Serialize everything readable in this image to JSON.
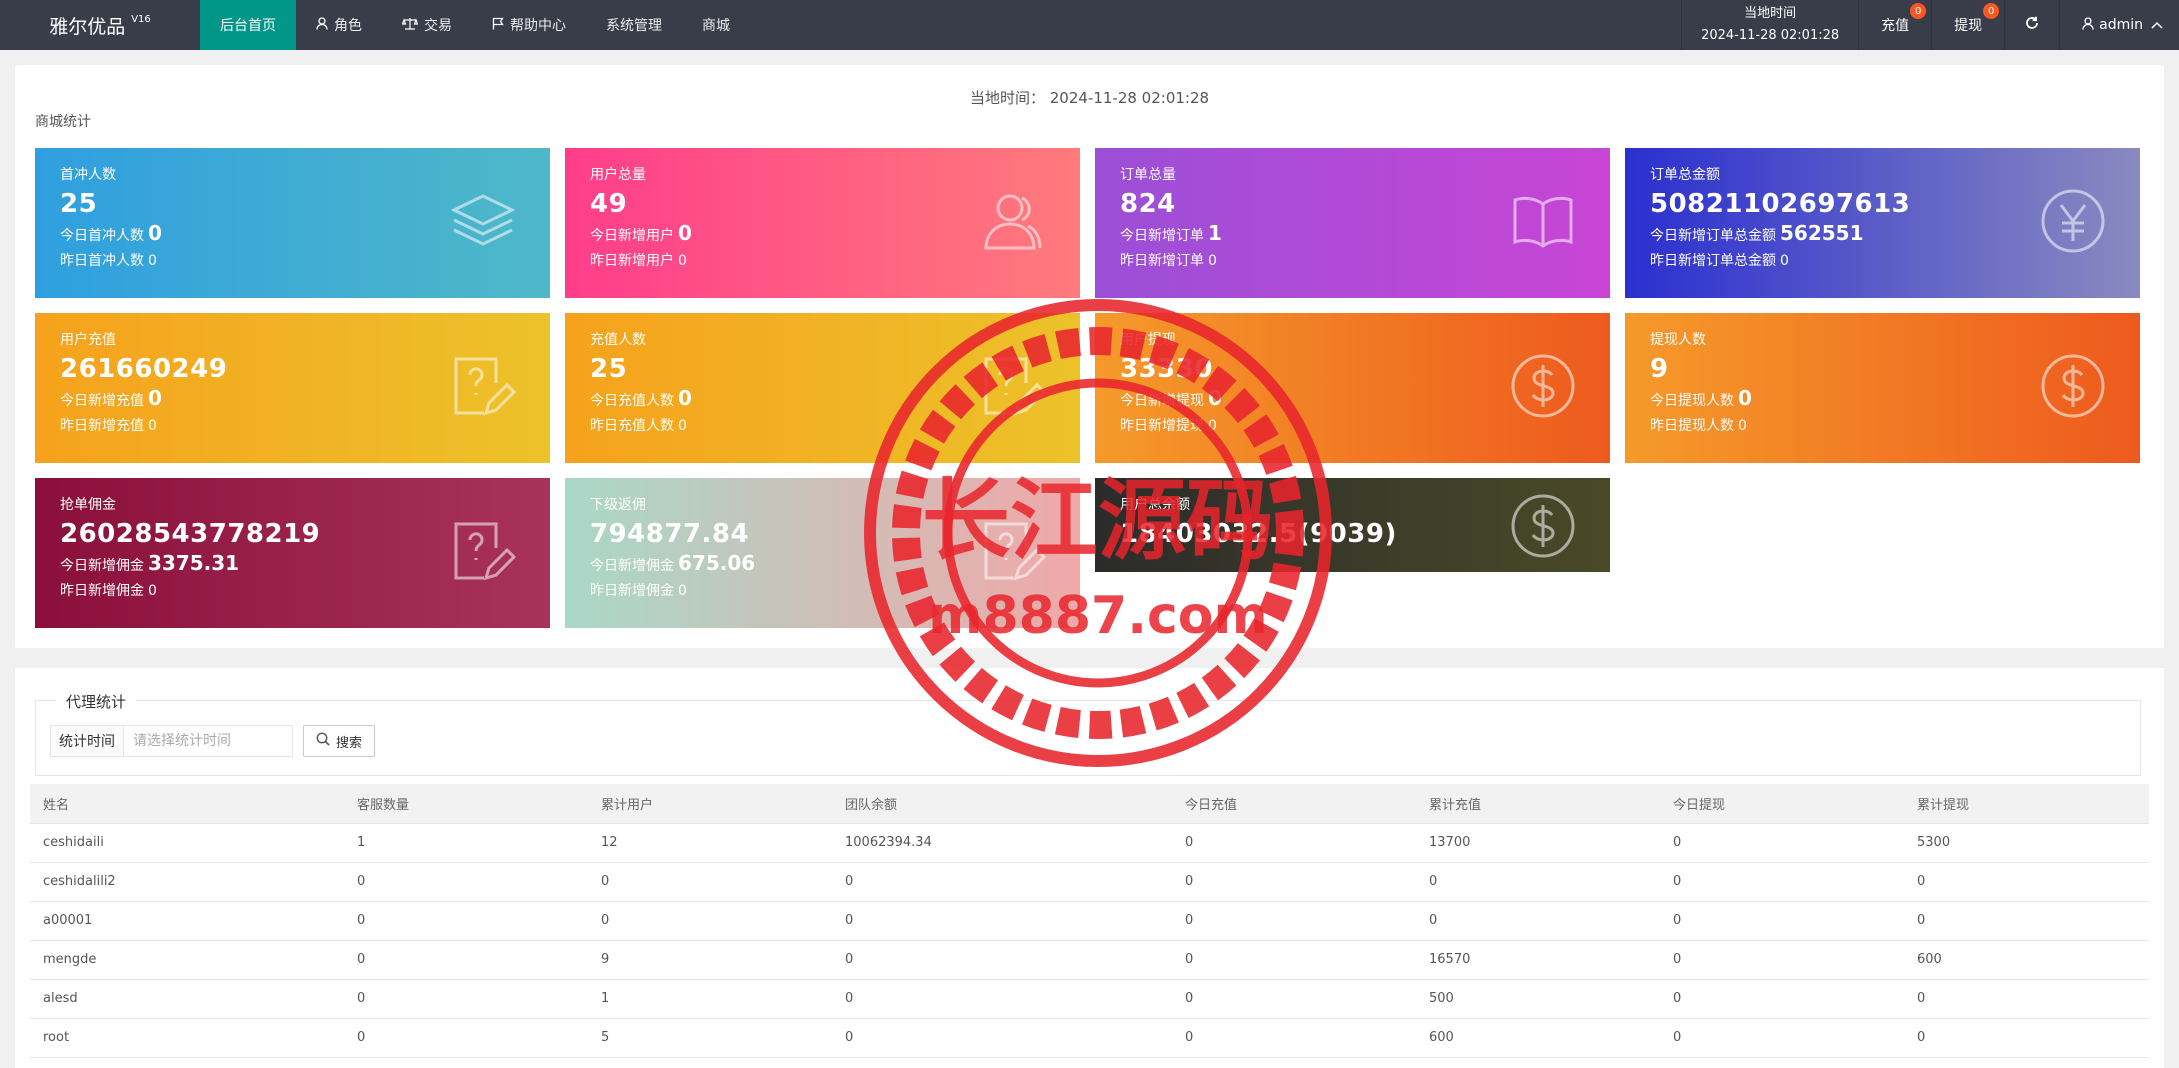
{
  "app": {
    "name": "雅尔优品",
    "version": "V16"
  },
  "nav": [
    {
      "label": "后台首页",
      "icon": ""
    },
    {
      "label": "角色",
      "icon": "user-icon"
    },
    {
      "label": "交易",
      "icon": "scale-icon"
    },
    {
      "label": "帮助中心",
      "icon": "flag-icon"
    },
    {
      "label": "系统管理",
      "icon": ""
    },
    {
      "label": "商城",
      "icon": ""
    }
  ],
  "header": {
    "time_label": "当地时间",
    "time_value": "2024-11-28 02:01:28",
    "recharge_label": "充值",
    "recharge_badge": "0",
    "withdraw_label": "提现",
    "withdraw_badge": "0",
    "user": "admin"
  },
  "dashboard": {
    "local_time_prefix": "当地时间：",
    "local_time": "2024-11-28 02:01:28",
    "section_title": "商城统计",
    "cards": [
      {
        "label": "首冲人数",
        "value": "25",
        "today_label": "今日首冲人数",
        "today": "0",
        "yest_label": "昨日首冲人数",
        "yest": "0",
        "icon": "layers-icon",
        "bg": [
          "#2f9fe0",
          "#4fb8c8"
        ]
      },
      {
        "label": "用户总量",
        "value": "49",
        "today_label": "今日新增用户",
        "today": "0",
        "yest_label": "昨日新增用户",
        "yest": "0",
        "icon": "users-icon",
        "bg": [
          "#ff3d8b",
          "#ff7b7b"
        ]
      },
      {
        "label": "订单总量",
        "value": "824",
        "today_label": "今日新增订单",
        "today": "1",
        "yest_label": "昨日新增订单",
        "yest": "0",
        "icon": "book-icon",
        "bg": [
          "#9b4fd6",
          "#c845d6"
        ]
      },
      {
        "label": "订单总金额",
        "value": "50821102697613",
        "today_label": "今日新增订单总金额",
        "today": "562551",
        "yest_label": "昨日新增订单总金额",
        "yest": "0",
        "icon": "yen-icon",
        "bg": [
          "#2b2fcf",
          "#8a8ac0"
        ]
      },
      {
        "label": "用户充值",
        "value": "261660249",
        "today_label": "今日新增充值",
        "today": "0",
        "yest_label": "昨日新增充值",
        "yest": "0",
        "icon": "edit-doc-icon",
        "bg": [
          "#f6a21c",
          "#ecc22a"
        ]
      },
      {
        "label": "充值人数",
        "value": "25",
        "today_label": "今日充值人数",
        "today": "0",
        "yest_label": "昨日充值人数",
        "yest": "0",
        "icon": "edit-doc-icon",
        "bg": [
          "#f6a21c",
          "#ecc22a"
        ]
      },
      {
        "label": "用户提现",
        "value": "33330",
        "today_label": "今日新增提现",
        "today": "0",
        "yest_label": "昨日新增提现",
        "yest": "0",
        "icon": "dollar-icon",
        "bg": [
          "#f59a2a",
          "#ee5a1e"
        ]
      },
      {
        "label": "提现人数",
        "value": "9",
        "today_label": "今日提现人数",
        "today": "0",
        "yest_label": "昨日提现人数",
        "yest": "0",
        "icon": "dollar-icon",
        "bg": [
          "#f59a2a",
          "#ee5a1e"
        ]
      },
      {
        "label": "抢单佣金",
        "value": "26028543778219",
        "today_label": "今日新增佣金",
        "today": "3375.31",
        "yest_label": "昨日新增佣金",
        "yest": "0",
        "icon": "edit-doc-icon",
        "bg": [
          "#8a0f3a",
          "#a8335a"
        ]
      },
      {
        "label": "下级返佣",
        "value": "794877.84",
        "today_label": "今日新增佣金",
        "today": "675.06",
        "yest_label": "昨日新增佣金",
        "yest": "0",
        "icon": "edit-doc-icon",
        "bg": [
          "#a9d8c8",
          "#f0a8a8"
        ]
      },
      {
        "label": "用户总余额",
        "value": "18403032.5(9039)",
        "icon": "dollar-icon",
        "bg": [
          "#2b2b2b",
          "#4a4a28"
        ]
      }
    ]
  },
  "agents": {
    "legend": "代理统计",
    "search_label": "统计时间",
    "search_placeholder": "请选择统计时间",
    "search_button": "搜索",
    "columns": [
      "姓名",
      "客服数量",
      "累计用户",
      "团队余额",
      "今日充值",
      "累计充值",
      "今日提现",
      "累计提现"
    ],
    "rows": [
      [
        "ceshidaili",
        "1",
        "12",
        "10062394.34",
        "0",
        "13700",
        "0",
        "5300"
      ],
      [
        "ceshidalili2",
        "0",
        "0",
        "0",
        "0",
        "0",
        "0",
        "0"
      ],
      [
        "a00001",
        "0",
        "0",
        "0",
        "0",
        "0",
        "0",
        "0"
      ],
      [
        "mengde",
        "0",
        "9",
        "0",
        "0",
        "16570",
        "0",
        "600"
      ],
      [
        "alesd",
        "0",
        "1",
        "0",
        "0",
        "500",
        "0",
        "0"
      ],
      [
        "root",
        "0",
        "5",
        "0",
        "0",
        "600",
        "0",
        "0"
      ]
    ]
  },
  "watermark": {
    "text1": "长江源码",
    "text2": "m8887.com",
    "color": "#e8242c"
  }
}
